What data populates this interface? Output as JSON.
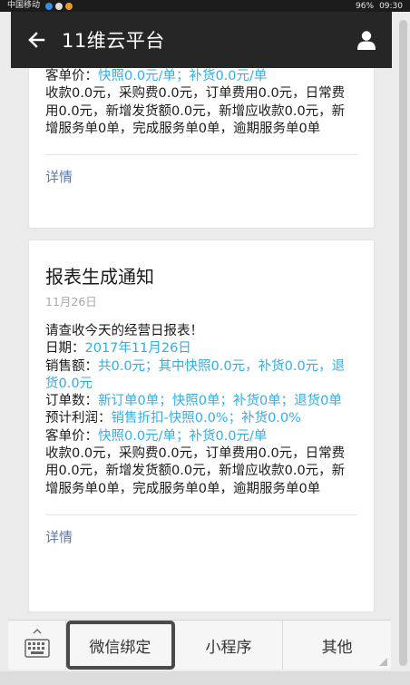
{
  "status_bar": {
    "carrier": "中国移动",
    "battery": "96%",
    "time": "09:30"
  },
  "app_bar": {
    "title": "11维云平台"
  },
  "card1": {
    "lines": [
      {
        "label": "客单价：",
        "value": "快照0.0元/单；补货0.0元/单"
      },
      {
        "text": "收款0.0元，采购费0.0元，订单费用0.0元，日常费用0.0元，新增发货额0.0元，新增应收款0.0元，新增服务单0单，完成服务单0单，逾期服务单0单"
      }
    ],
    "detail": "详情"
  },
  "card2": {
    "title": "报表生成通知",
    "date": "11月26日",
    "intro": "请查收今天的经营日报表！",
    "date_label": "日期：",
    "date_value": "2017年11月26日",
    "sales_label": "销售额：",
    "sales_value": "共0.0元；其中快照0.0元，补货0.0元，退货0.0元",
    "orders_label": "订单数：",
    "orders_value": "新订单0单；快照0单；补货0单；退货0单",
    "profit_label": "预计利润：",
    "profit_value": "销售折扣-快照0.0%；补货0.0%",
    "unit_label": "客单价：",
    "unit_value": "快照0.0元/单；补货0.0元/单",
    "summary": "收款0.0元，采购费0.0元，订单费用0.0元，日常费用0.0元，新增发货额0.0元，新增应收款0.0元，新增服务单0单，完成服务单0单，逾期服务单0单",
    "detail": "详情"
  },
  "bottom_menu": {
    "items": [
      "微信绑定",
      "小程序",
      "其他"
    ]
  }
}
